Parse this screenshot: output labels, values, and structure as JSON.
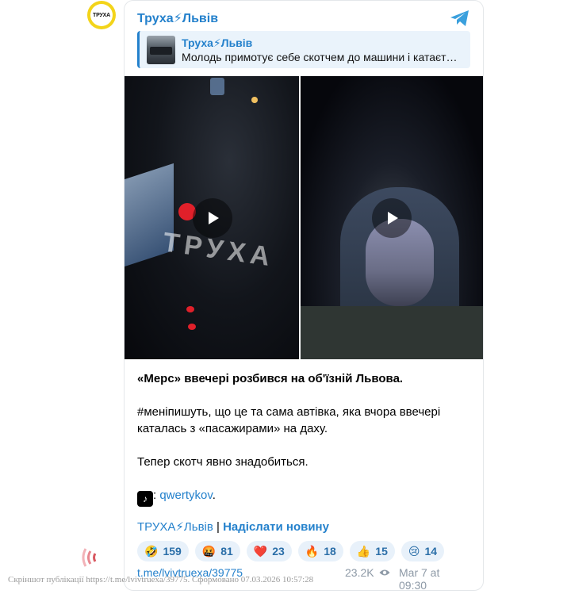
{
  "avatar": {
    "text": "ТРУХА"
  },
  "channel": {
    "name": "Труха⚡Львів"
  },
  "reply": {
    "title": "Труха⚡Львів",
    "text": "Молодь примотує себе скотчем до машини і катаєт…"
  },
  "media": {
    "watermark": "ТРУХА"
  },
  "message": {
    "headline": "«Мерс» ввечері розбився на об'їзній Львова.",
    "line2": "#меніпишуть, що це та сама автівка, яка вчора ввечері каталась з «пасажирами» на даху.",
    "line3": "Тепер скотч явно знадобиться.",
    "tiktok_icon": "tiktok-icon",
    "tiktok_prefix": ": ",
    "tiktok_handle": "qwertykov",
    "tiktok_suffix": "."
  },
  "signature": {
    "channel": "ТРУХА⚡Львів",
    "separator": " | ",
    "submit": "Надіслати новину"
  },
  "reactions": [
    {
      "emoji": "🤣",
      "count": "159"
    },
    {
      "emoji": "🤬",
      "count": "81"
    },
    {
      "emoji": "❤️",
      "count": "23"
    },
    {
      "emoji": "🔥",
      "count": "18"
    },
    {
      "emoji": "👍",
      "count": "15"
    },
    {
      "emoji": "😢",
      "count": "14"
    }
  ],
  "footer": {
    "url": "t.me/lvivtruexa/39775",
    "views": "23.2K",
    "date": "Mar 7 at 09:30"
  },
  "screenshot_note": "Скріншот публікації https://t.me/lvivtruexa/39775. Сформовано 07.03.2026 10:57:28",
  "colors": {
    "accent": "#2481cc",
    "avatar_ring": "#f3d41a",
    "reaction_bg": "#e8f1fa"
  }
}
